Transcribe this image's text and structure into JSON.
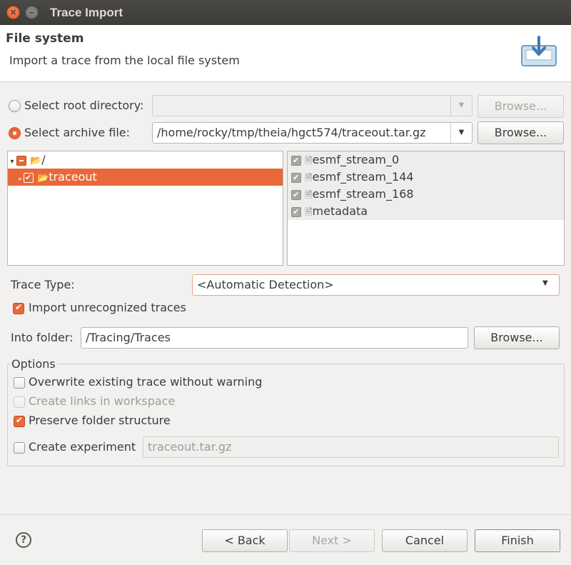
{
  "window": {
    "title": "Trace Import"
  },
  "banner": {
    "title": "File system",
    "description": "Import a trace from the local file system",
    "icon": "import-icon"
  },
  "source": {
    "root_directory": {
      "label": "Select root directory:",
      "selected": false,
      "value": "",
      "browse_label": "Browse..."
    },
    "archive_file": {
      "label": "Select archive file:",
      "selected": true,
      "value": "/home/rocky/tmp/theia/hgct574/traceout.tar.gz",
      "browse_label": "Browse..."
    }
  },
  "tree": {
    "root": {
      "label": "/",
      "state": "partial",
      "icon": "folder-open-icon"
    },
    "children": [
      {
        "label": "traceout",
        "state": "checked",
        "selected": true,
        "icon": "folder-open-icon"
      }
    ]
  },
  "files": [
    {
      "label": "esmf_stream_0",
      "checked": true,
      "icon": "file-icon"
    },
    {
      "label": "esmf_stream_144",
      "checked": true,
      "icon": "file-icon"
    },
    {
      "label": "esmf_stream_168",
      "checked": true,
      "icon": "file-icon"
    },
    {
      "label": "metadata",
      "checked": true,
      "icon": "file-icon"
    }
  ],
  "trace_type": {
    "label": "Trace Type:",
    "value": "<Automatic Detection>"
  },
  "import_unrecognized": {
    "label": "Import unrecognized traces",
    "checked": true
  },
  "into_folder": {
    "label": "Into folder:",
    "value": "/Tracing/Traces",
    "browse_label": "Browse..."
  },
  "options": {
    "legend": "Options",
    "overwrite": {
      "label": "Overwrite existing trace without warning",
      "checked": false
    },
    "create_links": {
      "label": "Create links in workspace",
      "checked": false,
      "disabled": true
    },
    "preserve_structure": {
      "label": "Preserve folder structure",
      "checked": true
    },
    "create_experiment": {
      "label": "Create experiment",
      "checked": false,
      "value": "traceout.tar.gz"
    }
  },
  "footer": {
    "back": "< Back",
    "next": "Next >",
    "cancel": "Cancel",
    "finish": "Finish",
    "help_icon": "help-icon"
  },
  "colors": {
    "accent": "#e9683a",
    "titlebar": "#3d3c38",
    "background": "#f2f1f0"
  }
}
